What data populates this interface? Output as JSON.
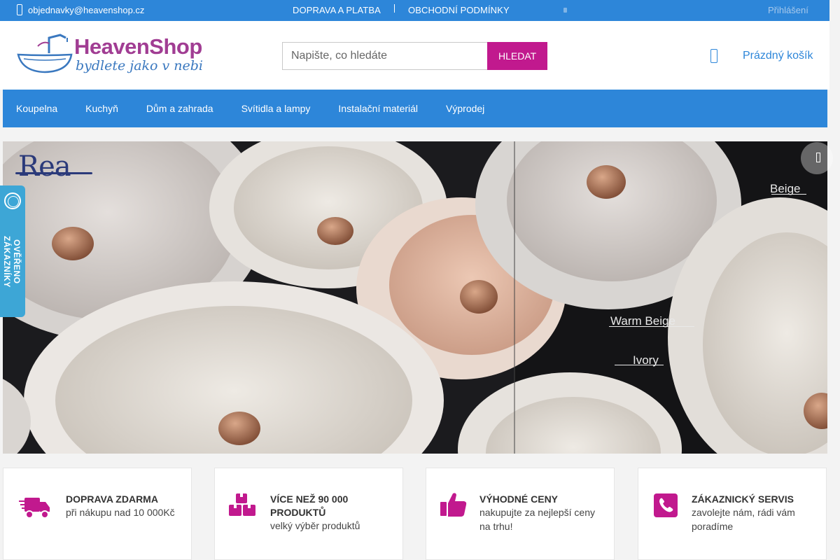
{
  "topbar": {
    "email": "objednavky@heavenshop.cz",
    "links": [
      "DOPRAVA A PLATBA",
      "OBCHODNÍ PODMÍNKY"
    ],
    "login": "Přihlášení"
  },
  "header": {
    "logo_name": "HeavenShop",
    "logo_tagline": "bydlete jako v nebi",
    "search_placeholder": "Napište, co hledáte",
    "search_button": "HLEDAT",
    "cart_label": "Prázdný košík"
  },
  "categories": [
    "Koupelna",
    "Kuchyň",
    "Dům a zahrada",
    "Svítidla a lampy",
    "Instalační materiál",
    "Výprodej"
  ],
  "banner": {
    "brand": "Rea",
    "labels": [
      "Beige",
      "Warm Beige",
      "Ivory"
    ]
  },
  "verified_badge": {
    "text": "OVĚŘENO ZÁKAZNÍKY"
  },
  "features": [
    {
      "title": "DOPRAVA ZDARMA",
      "desc": "při nákupu nad 10 000Kč",
      "icon": "truck-icon"
    },
    {
      "title": "VÍCE NEŽ 90 000 PRODUKTŮ",
      "desc": "velký výběr produktů",
      "icon": "boxes-icon"
    },
    {
      "title": "VÝHODNÉ CENY",
      "desc": "nakupujte za nejlepší ceny na trhu!",
      "icon": "thumbs-up-icon"
    },
    {
      "title": "ZÁKAZNICKÝ SERVIS",
      "desc": "zavolejte nám, rádi vám poradíme",
      "icon": "phone-icon"
    }
  ],
  "colors": {
    "primary_blue": "#2d86d9",
    "accent_magenta": "#c1198e",
    "logo_purple": "#a13d93"
  }
}
